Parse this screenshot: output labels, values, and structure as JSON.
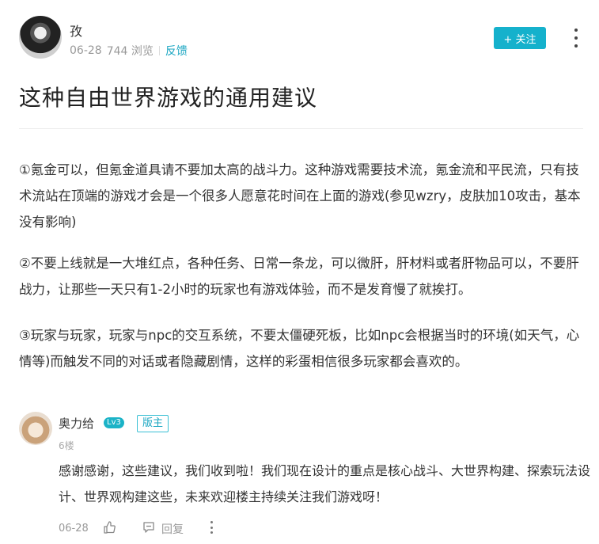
{
  "post": {
    "author": "孜",
    "date": "06-28",
    "views": "744 浏览",
    "feedback": "反馈",
    "follow_label": "+ 关注",
    "title": "这种自由世界游戏的通用建议",
    "paragraphs": [
      "①氪金可以，但氪金道具请不要加太高的战斗力。这种游戏需要技术流，氪金流和平民流，只有技术流站在顶端的游戏才会是一个很多人愿意花时间在上面的游戏(参见wzry，皮肤加10攻击，基本没有影响)",
      "②不要上线就是一大堆红点，各种任务、日常一条龙，可以微肝，肝材料或者肝物品可以，不要肝战力，让那些一天只有1-2小时的玩家也有游戏体验，而不是发育慢了就挨打。",
      "③玩家与玩家，玩家与npc的交互系统，不要太僵硬死板，比如npc会根据当时的环境(如天气，心情等)而触发不同的对话或者隐藏剧情，这样的彩蛋相信很多玩家都会喜欢的。"
    ]
  },
  "comment": {
    "author": "奥力给",
    "level": "Lv3",
    "role": "版主",
    "floor": "6楼",
    "text": "感谢感谢，这些建议，我们收到啦！我们现在设计的重点是核心战斗、大世界构建、探索玩法设计、世界观构建这些，未来欢迎楼主持续关注我们游戏呀！",
    "date": "06-28",
    "reply_label": "回复"
  },
  "icons": {
    "more": "more-vertical-icon",
    "like": "thumbs-up-icon",
    "reply": "comment-icon"
  },
  "colors": {
    "accent": "#15b1cc",
    "link": "#1aa6c2"
  }
}
